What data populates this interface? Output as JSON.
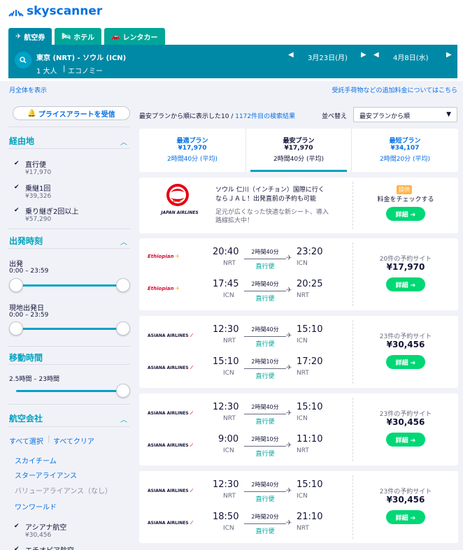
{
  "brand": {
    "name": "skyscanner"
  },
  "tabs": [
    {
      "label": "航空券",
      "icon": "plane-icon"
    },
    {
      "label": "ホテル",
      "icon": "bed-icon"
    },
    {
      "label": "レンタカー",
      "icon": "car-icon"
    }
  ],
  "search": {
    "route": "東京 (NRT) - ソウル (ICN)",
    "passengers": "1 大人",
    "cabin": "エコノミー",
    "depart_date": "3月23日(月)",
    "return_date": "4月8日(水)"
  },
  "links": {
    "month_view": "月全体を表示",
    "fees_note": "受託手荷物などの追加料金についてはこちら"
  },
  "filters": {
    "price_alert": "プライスアラートを受信",
    "stops": {
      "title": "経由地",
      "options": [
        {
          "label": "直行便",
          "price": "¥17,970"
        },
        {
          "label": "乗継1回",
          "price": "¥39,326"
        },
        {
          "label": "乗り継ぎ2回以上",
          "price": "¥57,290"
        }
      ]
    },
    "departure": {
      "title": "出発時刻",
      "outbound_label": "出発",
      "outbound_range": "0:00 – 23:59",
      "return_label": "現地出発日",
      "return_range": "0:00 – 23:59"
    },
    "duration": {
      "title": "移動時間",
      "range": "2.5時間 – 23時間"
    },
    "airlines": {
      "title": "航空会社",
      "select_all": "すべて選択",
      "clear_all": "すべてクリア",
      "alliances": [
        "スカイチーム",
        "スターアライアンス",
        "バリューアライアンス（なし）",
        "ワンワールド"
      ],
      "carriers": [
        {
          "label": "アシアナ航空",
          "price": "¥30,456"
        },
        {
          "label": "エチオピア航空",
          "price": ""
        }
      ]
    }
  },
  "results": {
    "summary_prefix": "最安プランから順に表示した10 / ",
    "summary_link": "1172件目の検索結果",
    "sort_label": "並べ替え",
    "sort_value": "最安プランから順"
  },
  "sort_tabs": [
    {
      "label": "最適プラン",
      "price": "¥17,970",
      "duration": "2時間40分 (平均)"
    },
    {
      "label": "最安プラン",
      "price": "¥17,970",
      "duration": "2時間40分 (平均)"
    },
    {
      "label": "最短プラン",
      "price": "¥34,107",
      "duration": "2時間20分 (平均)"
    }
  ],
  "ad": {
    "airline": "JAPAN AIRLINES",
    "logo_text": "JAL",
    "line1": "ソウル 仁川（インチョン）国際に行く",
    "line2": "ならＪＡＬ！出発直前の予約も可能",
    "line3": "足元が広くなった快適な新シート、導入",
    "line4": "路線拡大中！",
    "badge": "提供",
    "cta_text": "料金をチェックする",
    "button": "詳細 ➔"
  },
  "flights": [
    {
      "airline": "Ethiopian",
      "legs": [
        {
          "dep": "20:40",
          "dep_code": "NRT",
          "arr": "23:20",
          "arr_code": "ICN",
          "duration": "2時間40分",
          "stops": "直行便"
        },
        {
          "dep": "17:45",
          "dep_code": "ICN",
          "arr": "20:25",
          "arr_code": "NRT",
          "duration": "2時間40分",
          "stops": "直行便"
        }
      ],
      "sites": "20件の予約サイト",
      "price": "¥17,970",
      "button": "詳細 ➔"
    },
    {
      "airline": "ASIANA AIRLINES",
      "legs": [
        {
          "dep": "12:30",
          "dep_code": "NRT",
          "arr": "15:10",
          "arr_code": "ICN",
          "duration": "2時間40分",
          "stops": "直行便"
        },
        {
          "dep": "15:10",
          "dep_code": "ICN",
          "arr": "17:20",
          "arr_code": "NRT",
          "duration": "2時間10分",
          "stops": "直行便"
        }
      ],
      "sites": "23件の予約サイト",
      "price": "¥30,456",
      "button": "詳細 ➔"
    },
    {
      "airline": "ASIANA AIRLINES",
      "legs": [
        {
          "dep": "12:30",
          "dep_code": "NRT",
          "arr": "15:10",
          "arr_code": "ICN",
          "duration": "2時間40分",
          "stops": "直行便"
        },
        {
          "dep": "9:00",
          "dep_code": "ICN",
          "arr": "11:10",
          "arr_code": "NRT",
          "duration": "2時間10分",
          "stops": "直行便"
        }
      ],
      "sites": "23件の予約サイト",
      "price": "¥30,456",
      "button": "詳細 ➔"
    },
    {
      "airline": "ASIANA AIRLINES",
      "legs": [
        {
          "dep": "12:30",
          "dep_code": "NRT",
          "arr": "15:10",
          "arr_code": "ICN",
          "duration": "2時間40分",
          "stops": "直行便"
        },
        {
          "dep": "18:50",
          "dep_code": "ICN",
          "arr": "21:10",
          "arr_code": "NRT",
          "duration": "2時間20分",
          "stops": "直行便"
        }
      ],
      "sites": "23件の予約サイト",
      "price": "¥30,456",
      "button": "詳細 ➔"
    }
  ],
  "colors": {
    "brand": "#0770e3",
    "accent": "#00a3bf",
    "header_bar": "#0089a6",
    "cta": "#00d775",
    "jal": "#e60012",
    "asiana": "#e60012",
    "ethiopian": "#d21034"
  }
}
